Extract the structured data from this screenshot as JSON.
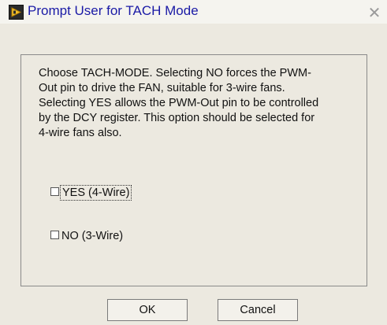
{
  "window": {
    "title": "Prompt User for TACH Mode",
    "close_icon": "close-icon"
  },
  "dialog": {
    "message": "Choose TACH-MODE. Selecting NO forces the PWM-\nOut pin to drive the FAN, suitable for 3-wire fans.\nSelecting YES allows the PWM-Out pin to be controlled\nby the DCY register. This option should be selected for\n4-wire fans also.",
    "options": [
      {
        "label": "YES (4-Wire)",
        "checked": false,
        "focused": true
      },
      {
        "label": "NO (3-Wire)",
        "checked": false,
        "focused": false
      }
    ]
  },
  "buttons": {
    "ok_label": "OK",
    "cancel_label": "Cancel"
  }
}
